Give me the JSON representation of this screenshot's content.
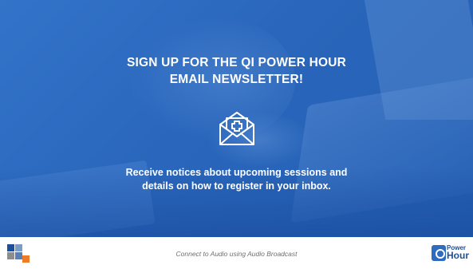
{
  "slide": {
    "title_line1": "SIGN UP FOR THE  QI POWER HOUR",
    "title_line2": "EMAIL NEWSLETTER!",
    "description_line1": "Receive notices about upcoming sessions and",
    "description_line2": "details on how to register in your inbox.",
    "icon": "envelope-medical-icon"
  },
  "footer": {
    "text": "Connect to Audio using Audio Broadcast",
    "left_logo_icon": "colored-squares-logo",
    "right_logo": {
      "line1": "Power",
      "line2": "Hour"
    }
  },
  "colors": {
    "accent": "#2e6bbd",
    "footer_bg": "#ffffff",
    "logo_orange": "#f07b26",
    "logo_blue": "#1d4f9a"
  }
}
